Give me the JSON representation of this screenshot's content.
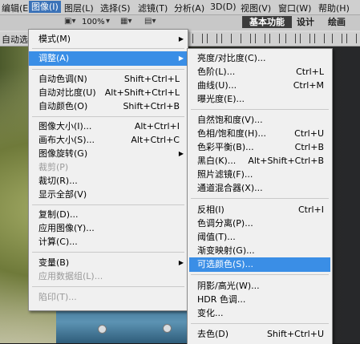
{
  "menubar": {
    "items": [
      "编辑(E)",
      "图像(I)",
      "图层(L)",
      "选择(S)",
      "滤镜(T)",
      "分析(A)",
      "3D(D)",
      "视图(V)",
      "窗口(W)",
      "帮助(H)"
    ],
    "zoom": "100%",
    "workspaces": [
      "基本功能",
      "设计",
      "绘画"
    ]
  },
  "options": {
    "auto_select": "自动选"
  },
  "image_menu": {
    "items": [
      {
        "label": "模式(M)",
        "shortcut": "",
        "submenu": true
      },
      {
        "label": "调整(A)",
        "shortcut": "",
        "submenu": true
      },
      {
        "label": "自动色调(N)",
        "shortcut": "Shift+Ctrl+L"
      },
      {
        "label": "自动对比度(U)",
        "shortcut": "Alt+Shift+Ctrl+L"
      },
      {
        "label": "自动颜色(O)",
        "shortcut": "Shift+Ctrl+B"
      },
      {
        "label": "图像大小(I)...",
        "shortcut": "Alt+Ctrl+I"
      },
      {
        "label": "画布大小(S)...",
        "shortcut": "Alt+Ctrl+C"
      },
      {
        "label": "图像旋转(G)",
        "shortcut": "",
        "submenu": true
      },
      {
        "label": "裁剪(P)",
        "shortcut": ""
      },
      {
        "label": "裁切(R)...",
        "shortcut": ""
      },
      {
        "label": "显示全部(V)",
        "shortcut": ""
      },
      {
        "label": "复制(D)...",
        "shortcut": ""
      },
      {
        "label": "应用图像(Y)...",
        "shortcut": ""
      },
      {
        "label": "计算(C)...",
        "shortcut": ""
      },
      {
        "label": "变量(B)",
        "shortcut": "",
        "submenu": true
      },
      {
        "label": "应用数据组(L)...",
        "shortcut": ""
      },
      {
        "label": "陷印(T)...",
        "shortcut": ""
      }
    ]
  },
  "adjust_menu": {
    "items": [
      {
        "label": "亮度/对比度(C)...",
        "shortcut": ""
      },
      {
        "label": "色阶(L)...",
        "shortcut": "Ctrl+L"
      },
      {
        "label": "曲线(U)...",
        "shortcut": "Ctrl+M"
      },
      {
        "label": "曝光度(E)...",
        "shortcut": ""
      },
      {
        "label": "自然饱和度(V)...",
        "shortcut": ""
      },
      {
        "label": "色相/饱和度(H)...",
        "shortcut": "Ctrl+U"
      },
      {
        "label": "色彩平衡(B)...",
        "shortcut": "Ctrl+B"
      },
      {
        "label": "黑白(K)...",
        "shortcut": "Alt+Shift+Ctrl+B"
      },
      {
        "label": "照片滤镜(F)...",
        "shortcut": ""
      },
      {
        "label": "通道混合器(X)...",
        "shortcut": ""
      },
      {
        "label": "反相(I)",
        "shortcut": "Ctrl+I"
      },
      {
        "label": "色调分离(P)...",
        "shortcut": ""
      },
      {
        "label": "阈值(T)...",
        "shortcut": ""
      },
      {
        "label": "渐变映射(G)...",
        "shortcut": ""
      },
      {
        "label": "可选颜色(S)...",
        "shortcut": ""
      },
      {
        "label": "阴影/高光(W)...",
        "shortcut": ""
      },
      {
        "label": "HDR 色调...",
        "shortcut": ""
      },
      {
        "label": "变化...",
        "shortcut": ""
      },
      {
        "label": "去色(D)",
        "shortcut": "Shift+Ctrl+U"
      }
    ]
  },
  "colors": {
    "highlight": "#3a8ee6",
    "menubar_active": "#3a72b8",
    "workspace_active": "#3c3c3c"
  }
}
